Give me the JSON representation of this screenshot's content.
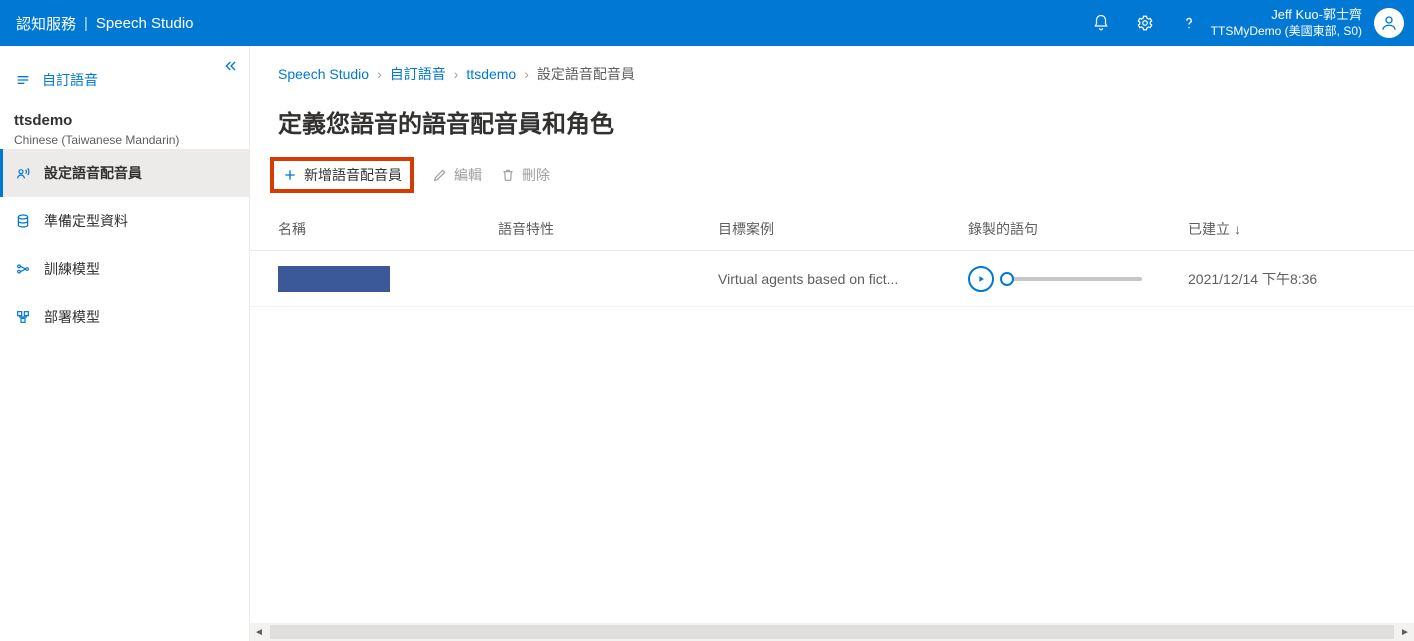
{
  "header": {
    "service": "認知服務",
    "product": "Speech Studio",
    "account_name": "Jeff Kuo-郭士齊",
    "account_sub": "TTSMyDemo (美國東部, S0)"
  },
  "sidebar": {
    "top_link": "自訂語音",
    "project_name": "ttsdemo",
    "project_lang": "Chinese (Taiwanese Mandarin)",
    "items": [
      {
        "label": "設定語音配音員"
      },
      {
        "label": "準備定型資料"
      },
      {
        "label": "訓練模型"
      },
      {
        "label": "部署模型"
      }
    ]
  },
  "breadcrumbs": {
    "items": [
      {
        "label": "Speech Studio"
      },
      {
        "label": "自訂語音"
      },
      {
        "label": "ttsdemo"
      },
      {
        "label": "設定語音配音員"
      }
    ]
  },
  "page": {
    "title": "定義您語音的語音配音員和角色"
  },
  "toolbar": {
    "add_label": "新增語音配音員",
    "edit_label": "編輯",
    "delete_label": "刪除"
  },
  "table": {
    "columns": {
      "name": "名稱",
      "voice_char": "語音特性",
      "target_case": "目標案例",
      "recorded": "錄製的語句",
      "created": "已建立",
      "sort_indicator": "↓"
    },
    "rows": [
      {
        "name": "",
        "voice_char": "",
        "target_case": "Virtual agents based on fict...",
        "created": "2021/12/14 下午8:36"
      }
    ]
  }
}
